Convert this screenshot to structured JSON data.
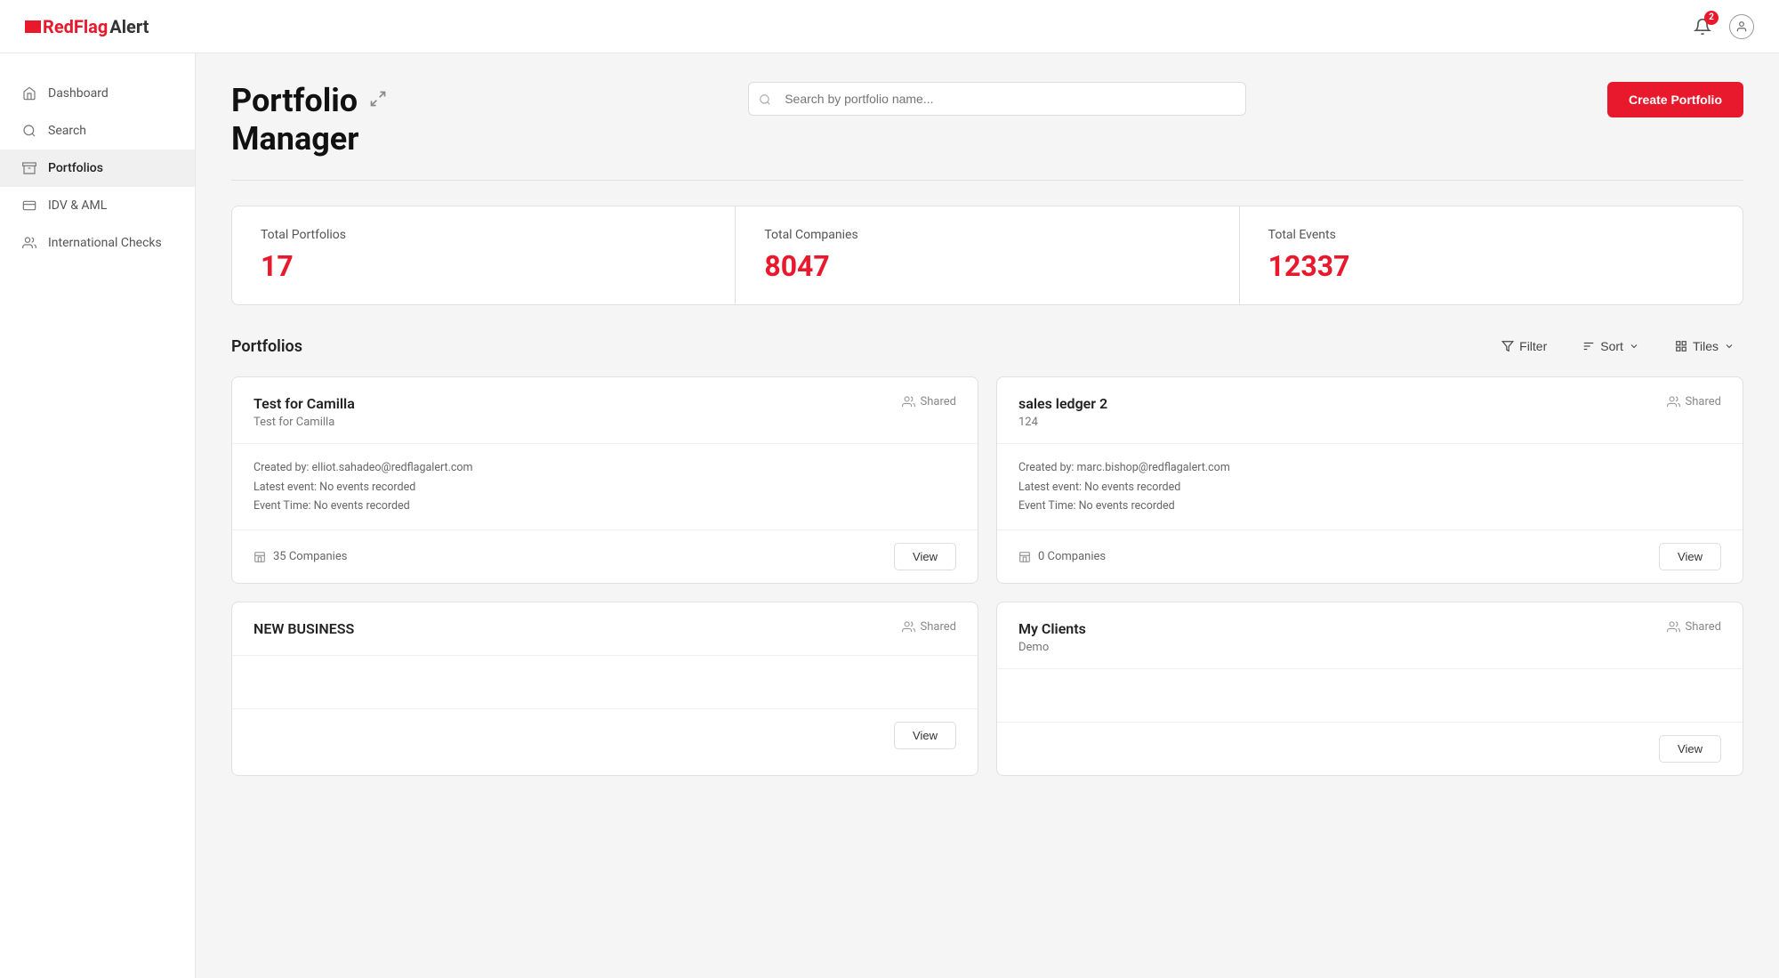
{
  "header": {
    "logo_text_red": "RedFlag",
    "logo_text_black": "Alert",
    "bell_badge": "2"
  },
  "sidebar": {
    "items": [
      {
        "id": "dashboard",
        "label": "Dashboard",
        "icon": "home"
      },
      {
        "id": "search",
        "label": "Search",
        "icon": "search"
      },
      {
        "id": "portfolios",
        "label": "Portfolios",
        "icon": "inbox",
        "active": true
      },
      {
        "id": "idv-aml",
        "label": "IDV & AML",
        "icon": "id-card"
      },
      {
        "id": "international-checks",
        "label": "International Checks",
        "icon": "users"
      }
    ]
  },
  "page": {
    "title_line1": "Portfolio",
    "title_line2": "Manager",
    "search_placeholder": "Search by portfolio name...",
    "create_button": "Create Portfolio"
  },
  "stats": [
    {
      "label": "Total Portfolios",
      "value": "17"
    },
    {
      "label": "Total Companies",
      "value": "8047"
    },
    {
      "label": "Total Events",
      "value": "12337"
    }
  ],
  "portfolios_section": {
    "title": "Portfolios",
    "filter_label": "Filter",
    "sort_label": "Sort",
    "tiles_label": "Tiles"
  },
  "portfolio_cards": [
    {
      "id": "card1",
      "name": "Test for Camilla",
      "subtitle": "Test for Camilla",
      "shared": "Shared",
      "created_by": "Created by: elliot.sahadeo@redflagalert.com",
      "latest_event": "Latest event: No events recorded",
      "event_time": "Event Time: No events recorded",
      "companies_count": "35 Companies",
      "view_label": "View"
    },
    {
      "id": "card2",
      "name": "sales ledger 2",
      "subtitle": "124",
      "shared": "Shared",
      "created_by": "Created by: marc.bishop@redflagalert.com",
      "latest_event": "Latest event: No events recorded",
      "event_time": "Event Time: No events recorded",
      "companies_count": "0 Companies",
      "view_label": "View"
    },
    {
      "id": "card3",
      "name": "NEW BUSINESS",
      "subtitle": "",
      "shared": "Shared",
      "created_by": "",
      "latest_event": "",
      "event_time": "",
      "companies_count": "",
      "view_label": "View"
    },
    {
      "id": "card4",
      "name": "My Clients",
      "subtitle": "Demo",
      "shared": "Shared",
      "created_by": "",
      "latest_event": "",
      "event_time": "",
      "companies_count": "",
      "view_label": "View"
    }
  ]
}
